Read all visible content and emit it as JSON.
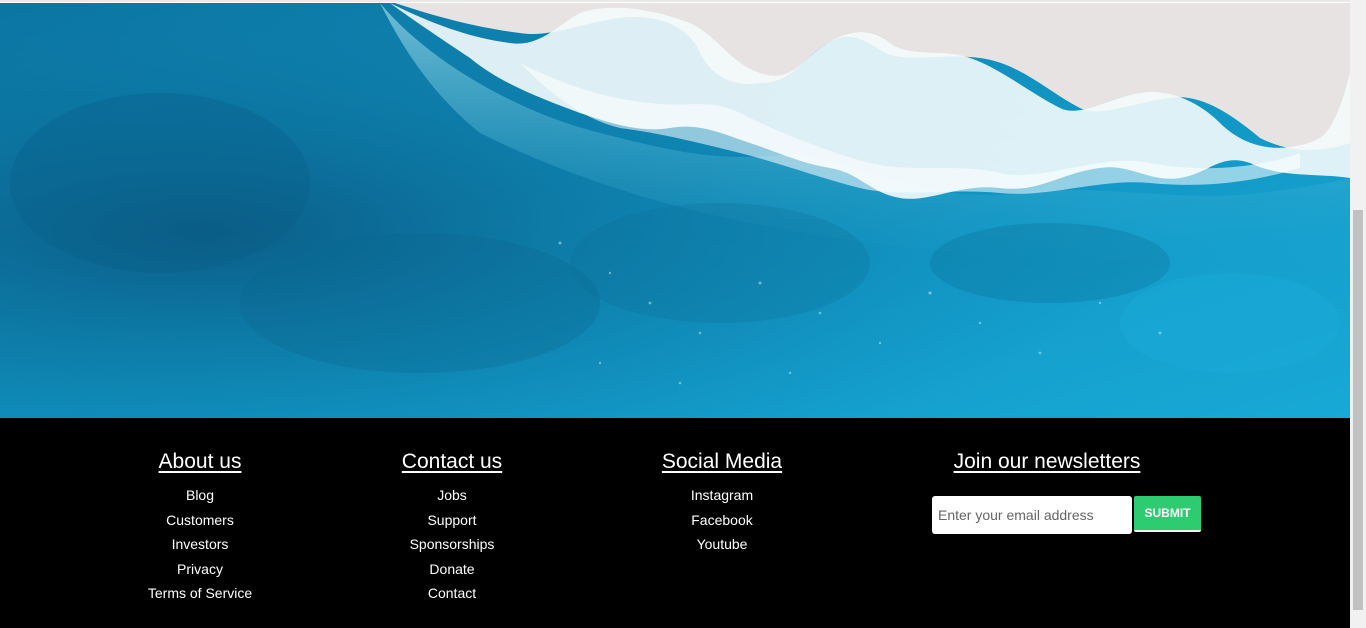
{
  "footer": {
    "about": {
      "heading": "About us",
      "links": [
        "Blog",
        "Customers",
        "Investors",
        "Privacy",
        "Terms of Service"
      ]
    },
    "contact": {
      "heading": "Contact us",
      "links": [
        "Jobs",
        "Support",
        "Sponsorships",
        "Donate",
        "Contact"
      ]
    },
    "social": {
      "heading": "Social Media",
      "links": [
        "Instagram",
        "Facebook",
        "Youtube"
      ]
    },
    "newsletter": {
      "heading": "Join our newsletters",
      "email_placeholder": "Enter your email address",
      "submit_label": "SUBMIT"
    }
  },
  "colors": {
    "footer_bg": "#000000",
    "submit_bg": "#2ecc71",
    "ocean": "#119bcc",
    "sand": "#e6e3e2"
  },
  "hero": {
    "image": "aerial ocean waves on sand beach"
  }
}
